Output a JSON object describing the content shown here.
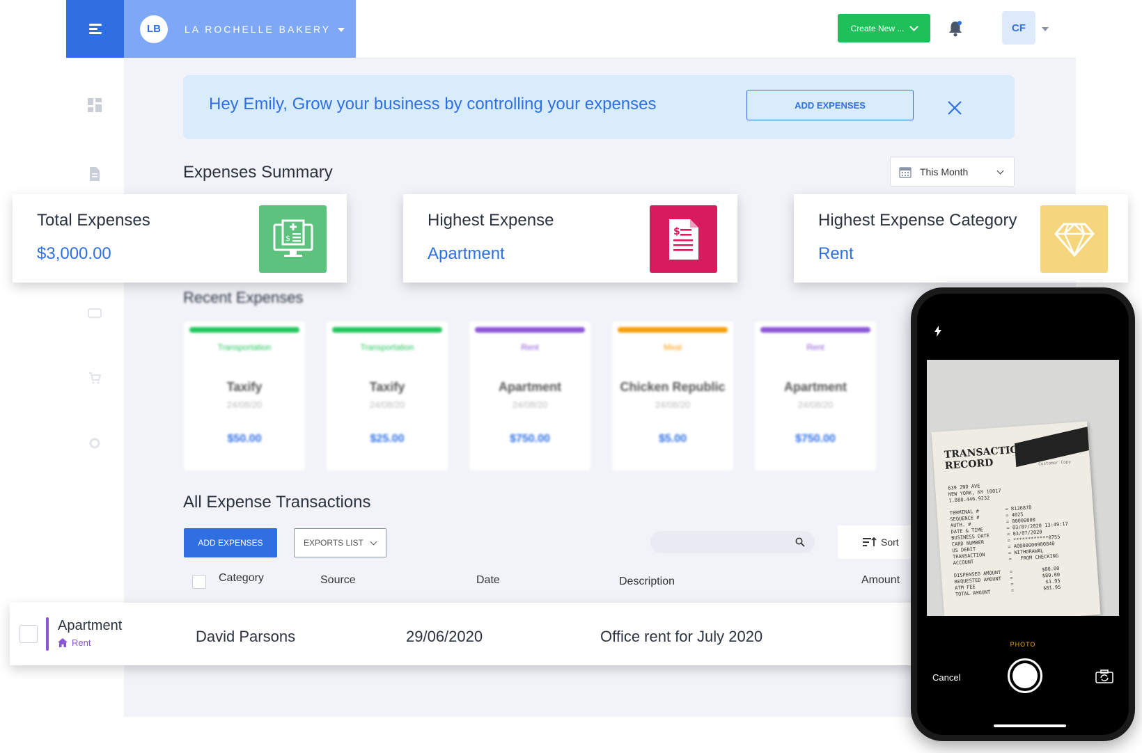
{
  "header": {
    "brand_initials": "LB",
    "brand_name": "LA ROCHELLE BAKERY",
    "create_button": "Create New ...",
    "user_initials": "CF"
  },
  "banner": {
    "greeting": "Hey Emily,  Grow your business by controlling your expenses",
    "add_button": "ADD EXPENSES"
  },
  "summary": {
    "title": "Expenses Summary",
    "period": "This Month",
    "cards": [
      {
        "label": "Total Expenses",
        "value": "$3,000.00",
        "icon": "computer-invoice-icon",
        "color": "#5ec27f"
      },
      {
        "label": "Highest Expense",
        "value": "Apartment",
        "icon": "document-dollar-icon",
        "color": "#d81b5c"
      },
      {
        "label": "Highest Expense Category",
        "value": "Rent",
        "icon": "diamond-icon",
        "color": "#f6d67c"
      }
    ]
  },
  "recent": {
    "title": "Recent Expenses",
    "items": [
      {
        "category": "Transportation",
        "title": "Taxify",
        "date": "24/08/20",
        "amount": "$50.00",
        "color": "#22c55e"
      },
      {
        "category": "Transportation",
        "title": "Taxify",
        "date": "24/08/20",
        "amount": "$25.00",
        "color": "#22c55e"
      },
      {
        "category": "Rent",
        "title": "Apartment",
        "date": "24/08/20",
        "amount": "$750.00",
        "color": "#8a56d6"
      },
      {
        "category": "Meal",
        "title": "Chicken Republic",
        "date": "24/08/20",
        "amount": "$5.00",
        "color": "#f59e0b"
      },
      {
        "category": "Rent",
        "title": "Apartment",
        "date": "24/08/20",
        "amount": "$750.00",
        "color": "#8a56d6"
      }
    ]
  },
  "transactions": {
    "title": "All Expense Transactions",
    "add_button": "ADD EXPENSES",
    "export_button": "EXPORTS LIST",
    "search_placeholder": "",
    "sort_label": "Sort",
    "columns": [
      "Category",
      "Source",
      "Date",
      "Description",
      "Amount"
    ],
    "rows": [
      {
        "category": "Apartment",
        "subcategory": "Rent",
        "source": "David Parsons",
        "date": "29/06/2020",
        "description": "Office rent for July 2020"
      }
    ]
  },
  "phone": {
    "mode": "PHOTO",
    "cancel": "Cancel",
    "receipt": {
      "title_line1": "TRANSACTION",
      "title_line2": "RECORD",
      "copy_label": "Customer Copy",
      "lines": [
        "639 2ND AVE",
        "NEW YORK, NY 10017",
        "1.888.446.9232",
        "",
        "TERMINAL #         = R126878",
        "SEQUENCE #         = 4025",
        "AUTH. #            = 00000000",
        "DATE & TIME        = 03/07/2020 13:49:17",
        "BUSINESS DATE      = 03/07/2020",
        "CARD NUMBER        = ************0755",
        "US DEBIT           = A0000000980840",
        "TRANSACTION        = WITHDRAWAL",
        "ACCOUNT            =   FROM CHECKING",
        "",
        "DISPENSED AMOUNT   =          $80.00",
        "REQUESTED AMOUNT   =          $80.00",
        "ATM FEE            =           $1.95",
        "TOTAL AMOUNT       =          $81.95"
      ]
    }
  }
}
